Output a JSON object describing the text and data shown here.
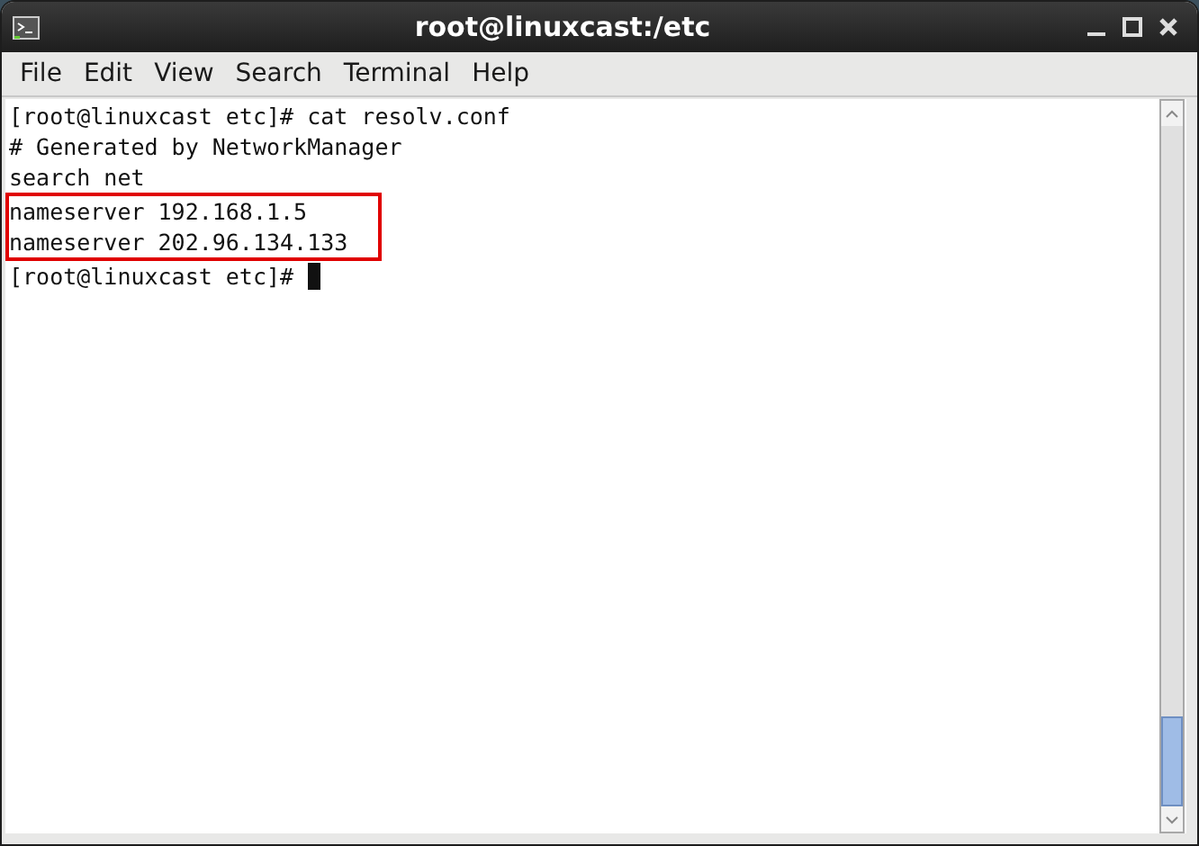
{
  "window": {
    "title": "root@linuxcast:/etc"
  },
  "menu": [
    "File",
    "Edit",
    "View",
    "Search",
    "Terminal",
    "Help"
  ],
  "terminal": {
    "lines": [
      {
        "text": "[root@linuxcast etc]# cat resolv.conf",
        "highlighted": false
      },
      {
        "text": "# Generated by NetworkManager",
        "highlighted": false
      },
      {
        "text": "search net",
        "highlighted": false
      },
      {
        "text": "nameserver 192.168.1.5",
        "highlighted": true
      },
      {
        "text": "nameserver 202.96.134.133",
        "highlighted": true
      },
      {
        "text": "[root@linuxcast etc]# ",
        "highlighted": false,
        "cursor": true
      }
    ]
  }
}
